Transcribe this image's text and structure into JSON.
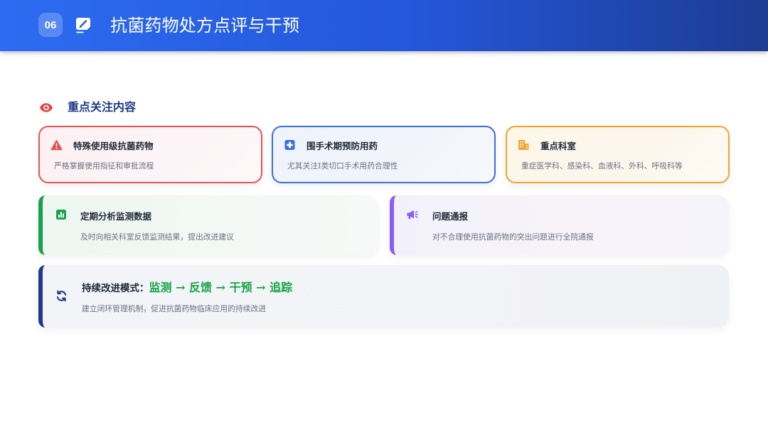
{
  "header": {
    "number": "06",
    "icon": "signature-icon",
    "title": "抗菌药物处方点评与干预",
    "color_start": "#2c6cf2",
    "color_end": "#1d3c93"
  },
  "section": {
    "icon": "eye-icon",
    "icon_color": "#e04848",
    "title": "重点关注内容"
  },
  "top_cards": [
    {
      "icon": "warning-icon",
      "color": "#e25555",
      "title": "特殊使用级抗菌药物",
      "desc": "严格掌握使用指征和审批流程"
    },
    {
      "icon": "medical-cross-icon",
      "color": "#3b6fe0",
      "title": "围手术期预防用药",
      "desc": "尤其关注I类切口手术用药合理性"
    },
    {
      "icon": "building-icon",
      "color": "#f0a52a",
      "title": "重点科室",
      "desc": "重症医学科、感染科、血液科、外科、呼吸科等"
    }
  ],
  "middle_cards": [
    {
      "icon": "bar-chart-icon",
      "color": "#16a34a",
      "title": "定期分析监测数据",
      "desc": "及时向相关科室反馈监测结果，提出改进建议"
    },
    {
      "icon": "megaphone-icon",
      "color": "#8b5cf6",
      "title": "问题通报",
      "desc": "对不合理使用抗菌药物的突出问题进行全院通报"
    }
  ],
  "bottom_card": {
    "icon": "sync-icon",
    "color": "#1e3a8a",
    "highlight_color": "#16a34a",
    "title_prefix": "持续改进模式：",
    "title_highlight": "监测 → 反馈 → 干预 → 追踪",
    "desc": "建立闭环管理机制，促进抗菌药物临床应用的持续改进"
  }
}
